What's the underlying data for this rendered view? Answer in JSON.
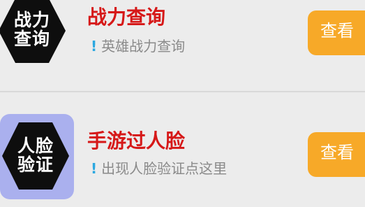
{
  "items": [
    {
      "icon_line1": "战力",
      "icon_line2": "查询",
      "icon_name": "hexagon-badge-icon",
      "title": "战力查询",
      "subtitle": "英雄战力查询",
      "bullet": "!",
      "button_label": "查看"
    },
    {
      "icon_line1": "人脸",
      "icon_line2": "验证",
      "icon_name": "hexagon-badge-icon",
      "title": "手游过人脸",
      "subtitle": "出现人脸验证点这里",
      "bullet": "!",
      "button_label": "查看"
    }
  ],
  "colors": {
    "background": "#ececec",
    "title": "#d61818",
    "subtitle": "#8a8a8a",
    "bullet": "#2ca8e0",
    "button": "#f7a928",
    "icon_tile_2": "#aab0ee",
    "hexagon": "#0e0e0e"
  }
}
